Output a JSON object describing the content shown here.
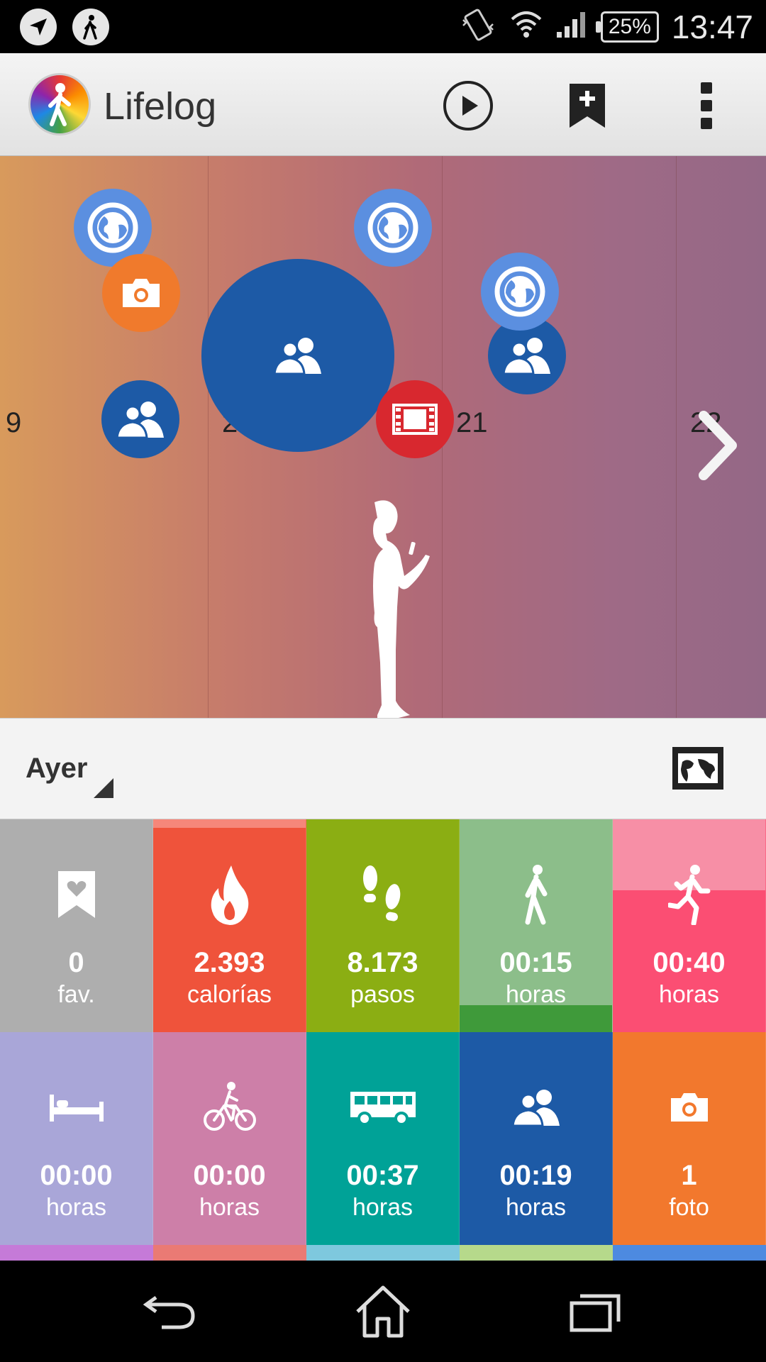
{
  "status_bar": {
    "time": "13:47",
    "battery": "25%",
    "icons": [
      "navigation-icon",
      "walking-icon",
      "vibrate-icon",
      "wifi-icon",
      "signal-icon",
      "battery-icon"
    ]
  },
  "app_bar": {
    "title": "Lifelog",
    "actions": [
      "play-icon",
      "bookmark-add-icon",
      "overflow-menu-icon"
    ]
  },
  "timeline": {
    "days": [
      "9",
      "20",
      "21",
      "22"
    ],
    "colors": {
      "web": "#5b8fe0",
      "photo": "#f07a2c",
      "social": "#1d5aa6",
      "video": "#d8282f"
    }
  },
  "date_header": {
    "label": "Ayer",
    "action_icon": "map-icon"
  },
  "tiles": [
    {
      "icon": "bookmark-heart-icon",
      "value": "0",
      "unit": "fav.",
      "color": "#aeaeae"
    },
    {
      "icon": "flame-icon",
      "value": "2.393",
      "unit": "calorías",
      "color": "#ef533b"
    },
    {
      "icon": "footsteps-icon",
      "value": "8.173",
      "unit": "pasos",
      "color": "#8bae13"
    },
    {
      "icon": "walk-icon",
      "value": "00:15",
      "unit": "horas",
      "color": "#8cbe8a"
    },
    {
      "icon": "run-icon",
      "value": "00:40",
      "unit": "horas",
      "color": "#fb4e73"
    },
    {
      "icon": "bed-icon",
      "value": "00:00",
      "unit": "horas",
      "color": "#a9a6d8"
    },
    {
      "icon": "bicycle-icon",
      "value": "00:00",
      "unit": "horas",
      "color": "#cd7fa8"
    },
    {
      "icon": "bus-icon",
      "value": "00:37",
      "unit": "horas",
      "color": "#00a297"
    },
    {
      "icon": "people-icon",
      "value": "00:19",
      "unit": "horas",
      "color": "#1d5aa6"
    },
    {
      "icon": "camera-icon",
      "value": "1",
      "unit": "foto",
      "color": "#f2782d"
    }
  ],
  "strip_colors": [
    "#c57ad8",
    "#ea7a74",
    "#7ec8de",
    "#b6d98b",
    "#4d8ae0"
  ],
  "nav_bar": [
    "back-icon",
    "home-icon",
    "recent-apps-icon"
  ]
}
